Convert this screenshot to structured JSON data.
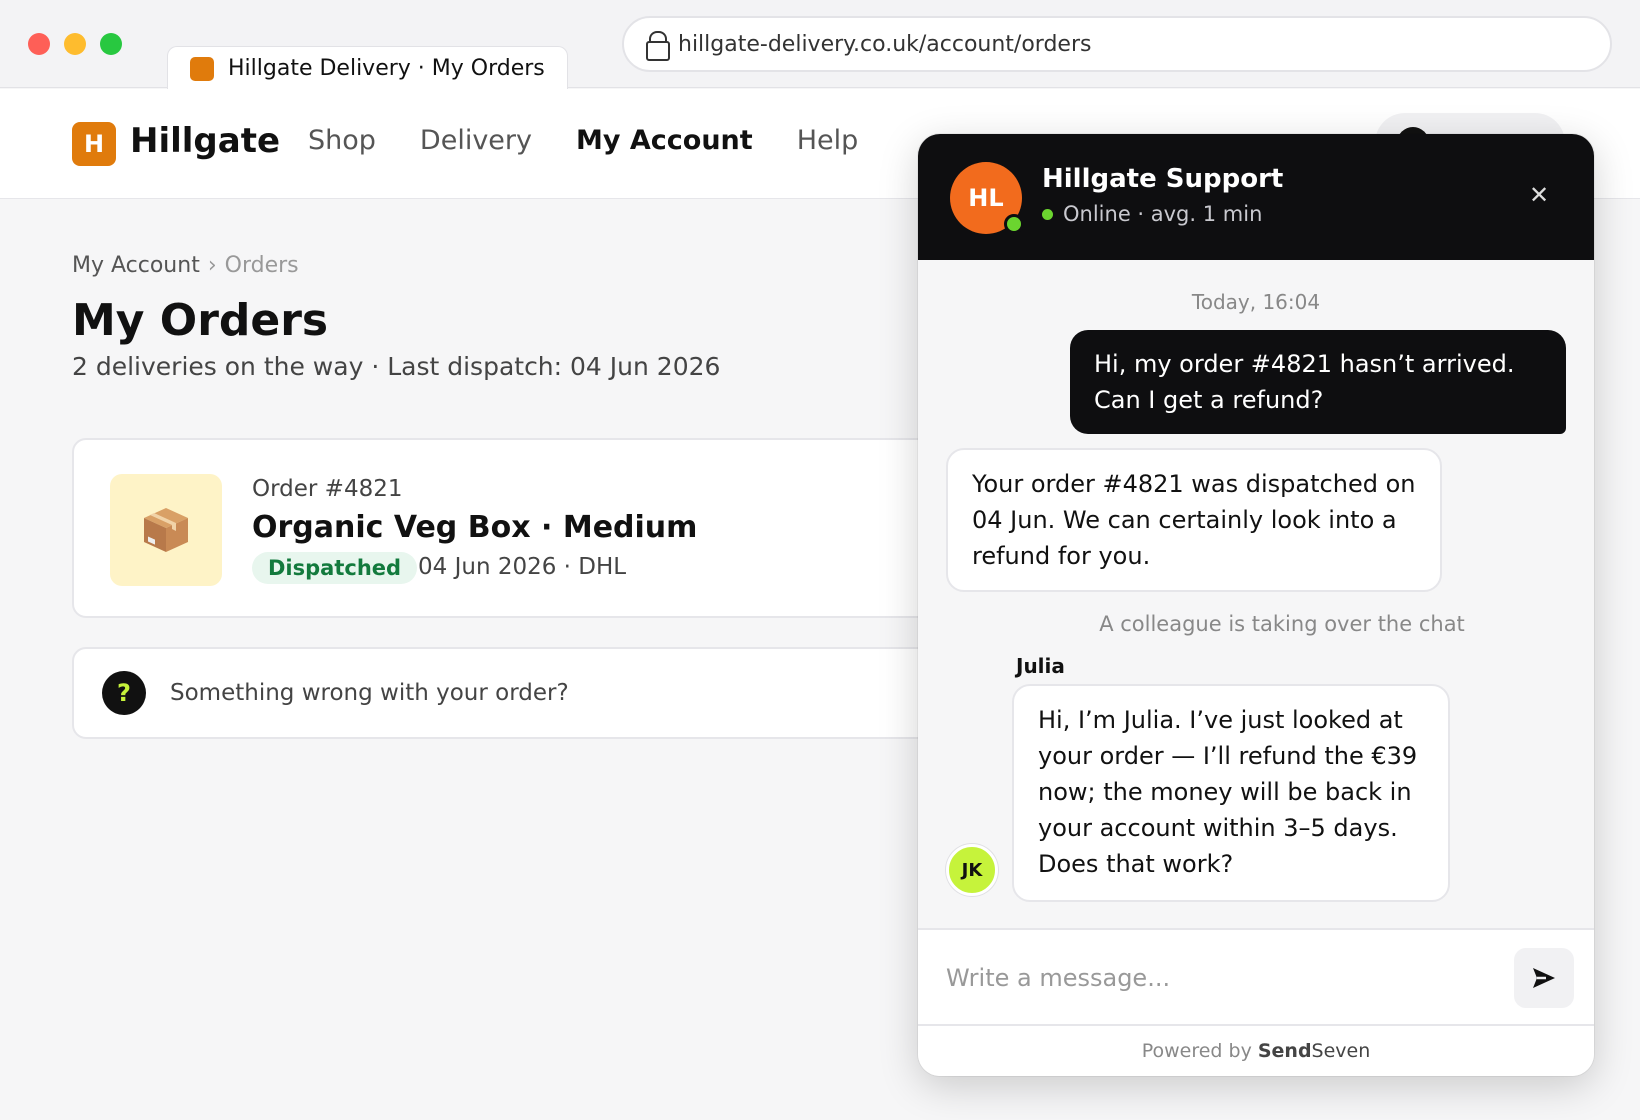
{
  "browser": {
    "tab_title": "Hillgate Delivery · My Orders",
    "url": "hillgate-delivery.co.uk/account/orders"
  },
  "site": {
    "logo_letter": "H",
    "logo_text": "Hillgate",
    "nav": [
      {
        "label": "Shop",
        "active": false
      },
      {
        "label": "Delivery",
        "active": false
      },
      {
        "label": "My Account",
        "active": true
      },
      {
        "label": "Help",
        "active": false
      }
    ],
    "brand_color": "#e07b0c"
  },
  "page": {
    "breadcrumb": {
      "parent": "My Account",
      "separator": "›",
      "current": "Orders"
    },
    "title": "My Orders",
    "subtitle": "2 deliveries on the way · Last dispatch: 04 Jun 2026",
    "order": {
      "number": "Order #4821",
      "name": "Organic Veg Box · Medium",
      "status": "Dispatched",
      "meta": "04 Jun 2026 · DHL",
      "icon": "package-icon"
    },
    "help_prompt": "Something wrong with your order?",
    "help_icon_glyph": "?"
  },
  "chat": {
    "agent_initials": "HL",
    "title": "Hillgate Support",
    "status": "Online · avg. 1 min",
    "close_glyph": "✕",
    "timestamp": "Today, 16:04",
    "messages": {
      "user": "Hi, my order #4821 hasn’t arrived. Can I get a refund?",
      "bot": "Your order #4821 was dispatched on 04 Jun. We can certainly look into a refund for you.",
      "takeover": "A colleague is taking over the chat",
      "julia_name": "Julia",
      "julia_initials": "JK",
      "julia": "Hi, I’m Julia. I’ve just looked at your order — I’ll refund the €39 now; the money will be back in your account within 3–5 days. Does that work?"
    },
    "input_placeholder": "Write a message...",
    "footer": {
      "prefix": "Powered by",
      "brand_bold": "Send",
      "brand_rest": "Seven"
    },
    "colors": {
      "header": "#0e0e10",
      "agent_avatar": "#f26b1d",
      "online": "#6bd52f",
      "julia_avatar": "#c6f33b"
    }
  }
}
